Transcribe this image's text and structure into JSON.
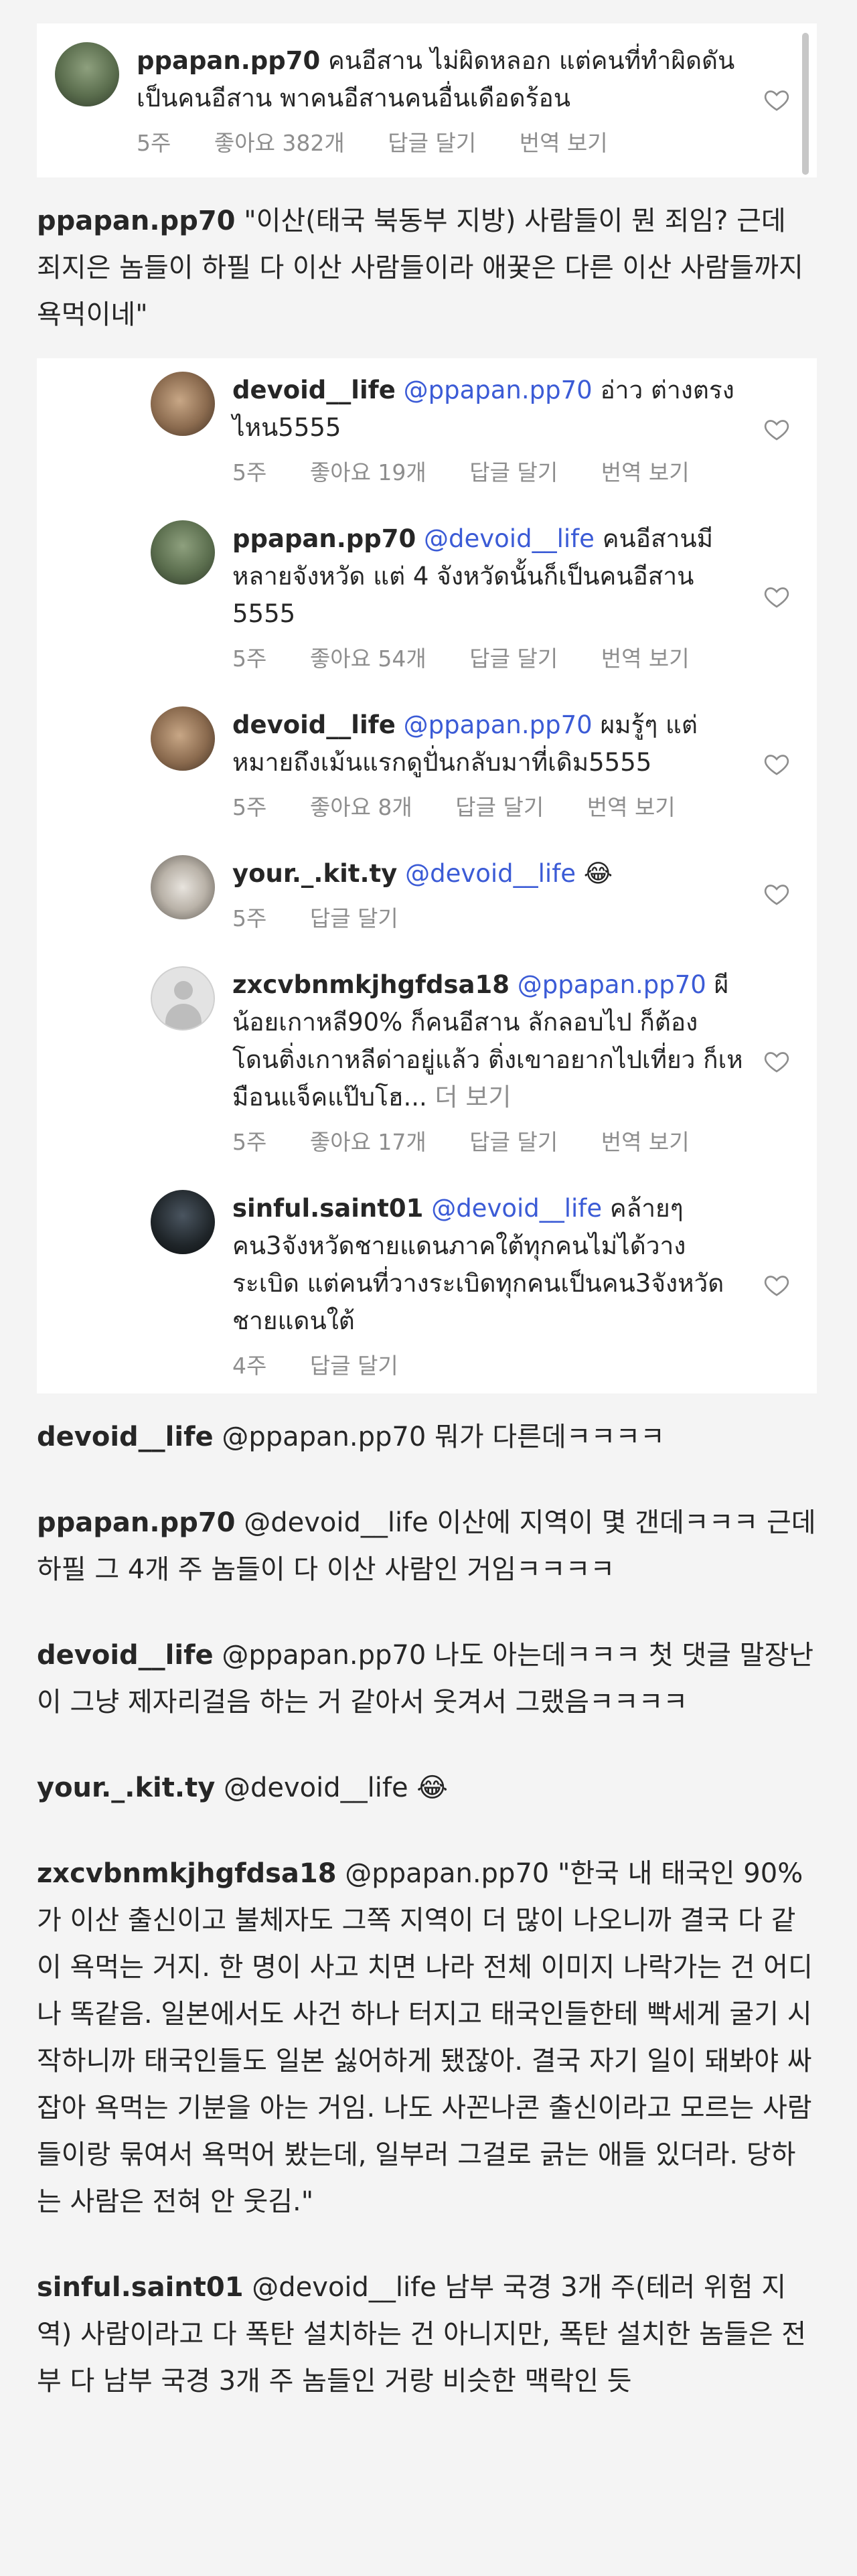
{
  "top_comment": {
    "username": "ppapan.pp70",
    "text": "คนอีสาน ไม่ผิดหลอก แต่คนที่ทำผิดดันเป็นคนอีสาน พาคนอีสานคนอื่นเดือดร้อน",
    "time": "5주",
    "likes": "좋아요 382개",
    "reply": "답글 달기",
    "translate": "번역 보기"
  },
  "translation_1": {
    "username": "ppapan.pp70",
    "text": "\"이산(태국 북동부 지방) 사람들이 뭔 죄임? 근데 죄지은 놈들이 하필 다 이산 사람들이라 애꿎은 다른 이산 사람들까지 욕먹이네\""
  },
  "replies": [
    {
      "username": "devoid__life",
      "mention": "@ppapan.pp70",
      "text": "อ่าว ต่างตรงไหน5555",
      "time": "5주",
      "likes": "좋아요 19개",
      "reply": "답글 달기",
      "translate": "번역 보기",
      "avatar": "brown"
    },
    {
      "username": "ppapan.pp70",
      "mention": "@devoid__life",
      "text": "คนอีสานมีหลายจังหวัด แต่ 4 จังหวัดนั้นก็เป็นคนอีสาน 5555",
      "time": "5주",
      "likes": "좋아요 54개",
      "reply": "답글 달기",
      "translate": "번역 보기",
      "avatar": "green"
    },
    {
      "username": "devoid__life",
      "mention": "@ppapan.pp70",
      "text": "ผมรู้ๆ แต่หมายถึงเม้นแรกดูปั่นกลับมาที่เดิม5555",
      "time": "5주",
      "likes": "좋아요 8개",
      "reply": "답글 달기",
      "translate": "번역 보기",
      "avatar": "brown"
    },
    {
      "username": "your._.kit.ty",
      "mention": "@devoid__life",
      "text": "😂",
      "time": "5주",
      "likes": "",
      "reply": "답글 달기",
      "translate": "",
      "avatar": "photo"
    },
    {
      "username": "zxcvbnmkjhgfdsa18",
      "mention": "@ppapan.pp70",
      "text": "ผีน้อยเกาหลี90% ก็คนอีสาน ลักลอบไป ก็ต้องโดนติ่งเกาหลีด่าอยู่แล้ว ติ่งเขาอยากไปเที่ยว ก็เหมือนแจ็คแป๊บโฮ...",
      "more": "더 보기",
      "time": "5주",
      "likes": "좋아요 17개",
      "reply": "답글 달기",
      "translate": "번역 보기",
      "avatar": "default"
    },
    {
      "username": "sinful.saint01",
      "mention": "@devoid__life",
      "text": "คล้ายๆคน3จังหวัดชายแดนภาคใต้ทุกคนไม่ได้วางระเบิด แต่คนที่วางระเบิดทุกคนเป็นคน3จังหวัดชายแดนใต้",
      "time": "4주",
      "likes": "",
      "reply": "답글 달기",
      "translate": "",
      "avatar": "dark"
    }
  ],
  "translations": [
    {
      "username": "devoid__life",
      "mention": "@ppapan.pp70",
      "text": "뭐가 다른데ㅋㅋㅋㅋ"
    },
    {
      "username": "ppapan.pp70",
      "mention": "@devoid__life",
      "text": "이산에 지역이 몇 갠데ㅋㅋㅋ 근데 하필 그 4개 주 놈들이 다 이산 사람인 거임ㅋㅋㅋㅋ"
    },
    {
      "username": "devoid__life",
      "mention": "@ppapan.pp70",
      "text": "나도 아는데ㅋㅋㅋ 첫 댓글 말장난이 그냥 제자리걸음 하는 거 같아서 웃겨서 그랬음ㅋㅋㅋㅋ"
    },
    {
      "username": "your._.kit.ty",
      "mention": "@devoid__life",
      "text": "😂"
    },
    {
      "username": "zxcvbnmkjhgfdsa18",
      "mention": "@ppapan.pp70",
      "text": "\"한국 내 태국인 90%가 이산 출신이고 불체자도 그쪽 지역이 더 많이 나오니까 결국 다 같이 욕먹는 거지. 한 명이 사고 치면 나라 전체 이미지 나락가는 건 어디나 똑같음. 일본에서도 사건 하나 터지고 태국인들한테 빡세게 굴기 시작하니까 태국인들도 일본 싫어하게 됐잖아. 결국 자기 일이 돼봐야 싸잡아 욕먹는 기분을 아는 거임. 나도 사꼰나콘 출신이라고 모르는 사람들이랑 묶여서 욕먹어 봤는데, 일부러 그걸로 긁는 애들 있더라. 당하는 사람은 전혀 안 웃김.\""
    },
    {
      "username": "sinful.saint01",
      "mention": "@devoid__life",
      "text": "남부 국경 3개 주(테러 위험 지역) 사람이라고 다 폭탄 설치하는 건 아니지만, 폭탄 설치한 놈들은 전부 다 남부 국경 3개 주 놈들인 거랑 비슷한 맥락인 듯"
    }
  ],
  "colors": {
    "mention": "#3b5bd6",
    "meta": "#8e8e8e",
    "text": "#262626"
  },
  "icons": {
    "like": "heart-outline-icon"
  }
}
